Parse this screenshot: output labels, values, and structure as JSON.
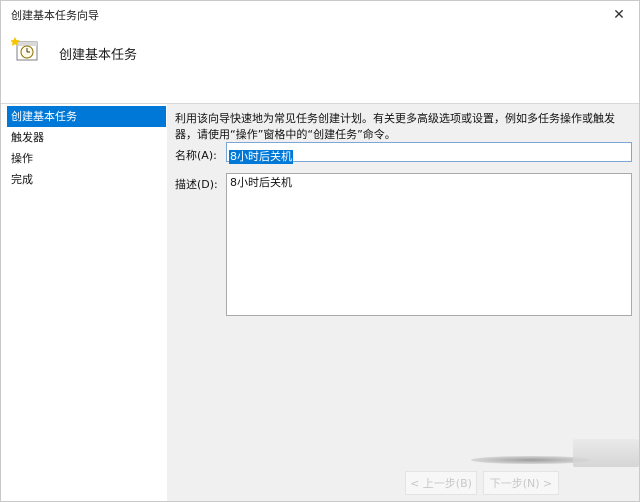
{
  "window": {
    "title": "创建基本任务向导",
    "close_glyph": "✕"
  },
  "header": {
    "title": "创建基本任务",
    "icon": "task-clock-icon"
  },
  "sidebar": {
    "items": [
      {
        "label": "创建基本任务",
        "active": true
      },
      {
        "label": "触发器",
        "active": false
      },
      {
        "label": "操作",
        "active": false
      },
      {
        "label": "完成",
        "active": false
      }
    ]
  },
  "main": {
    "description": "利用该向导快速地为常见任务创建计划。有关更多高级选项或设置，例如多任务操作或触发器，请使用“操作”窗格中的“创建任务”命令。",
    "name_label": "名称(A):",
    "name_value": "8小时后关机",
    "desc_label": "描述(D):",
    "desc_value": "8小时后关机"
  },
  "footer": {
    "prev_label": "< 上一步(B)",
    "next_label": "下一步(N) >"
  },
  "colors": {
    "accent": "#0078d7",
    "background": "#f0f0f0"
  }
}
